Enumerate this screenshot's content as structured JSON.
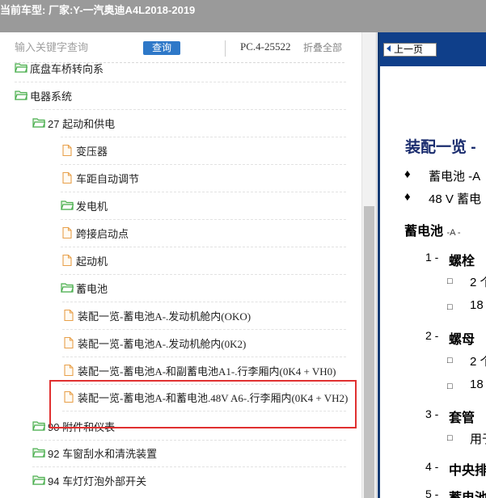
{
  "window": {
    "title": "当前车型:  厂家:Y-一汽奥迪A4L2018-2019"
  },
  "search": {
    "placeholder": "输入关键字查询",
    "button_label": "查询",
    "pc_code": "PC.4-25522",
    "collapse_label": "折叠全部"
  },
  "tree": [
    {
      "label": "底盘车桥转向系",
      "type": "folder",
      "level": 0
    },
    {
      "label": "电器系统",
      "type": "folder",
      "level": 0
    },
    {
      "label": "27 起动和供电",
      "type": "folder",
      "level": 1
    },
    {
      "label": "变压器",
      "type": "doc",
      "level": 2
    },
    {
      "label": "车距自动调节",
      "type": "doc",
      "level": 2
    },
    {
      "label": "发电机",
      "type": "folder",
      "level": 2
    },
    {
      "label": "跨接启动点",
      "type": "doc",
      "level": 2
    },
    {
      "label": "起动机",
      "type": "doc",
      "level": 2
    },
    {
      "label": "蓄电池",
      "type": "folder",
      "level": 2
    },
    {
      "label": "装配一览-蓄电池A-.发动机舱内(OKO)",
      "type": "doc",
      "level": 3
    },
    {
      "label": "装配一览-蓄电池A-.发动机舱内(0K2)",
      "type": "doc",
      "level": 3
    },
    {
      "label": "装配一览-蓄电池A-和副蓄电池A1-.行李厢内(0K4 + VH0)",
      "type": "doc",
      "level": 3
    },
    {
      "label": "装配一览-蓄电池A-和蓄电池.48V A6-.行李厢内(0K4 + VH2)",
      "type": "doc",
      "level": 3
    },
    {
      "label": "90 附件和仪表",
      "type": "folder",
      "level": 1
    },
    {
      "label": "92 车窗刮水和清洗装置",
      "type": "folder",
      "level": 1
    },
    {
      "label": "94 车灯灯泡外部开关",
      "type": "folder",
      "level": 1
    }
  ],
  "viewer": {
    "prev_label": "上一页",
    "heading": "装配一览 -",
    "bullets": [
      "蓄电池 -A",
      "48 V 蓄电"
    ],
    "section": "蓄电池",
    "section_suffix": "-A -",
    "items": [
      {
        "num": "1 -",
        "text": "螺栓",
        "subs": [
          "2 个",
          "18"
        ]
      },
      {
        "num": "2 -",
        "text": "螺母",
        "subs": [
          "2 个",
          "18"
        ]
      },
      {
        "num": "3 -",
        "text": "套管",
        "subs": [
          "用于"
        ]
      },
      {
        "num": "4 -",
        "text": "中央排"
      },
      {
        "num": "5 -",
        "text": "蓄电池"
      }
    ]
  },
  "colors": {
    "titlebar": "#9a9a9a",
    "search_button": "#2e78c8",
    "viewer_header": "#0f3f8a",
    "heading": "#1a2c6e",
    "folder_icon": "#4caf50",
    "doc_icon": "#e8a04a",
    "highlight": "#e03030"
  },
  "icons": {
    "folder": "folder-open-icon",
    "doc": "document-icon",
    "prev": "arrow-left-icon"
  }
}
